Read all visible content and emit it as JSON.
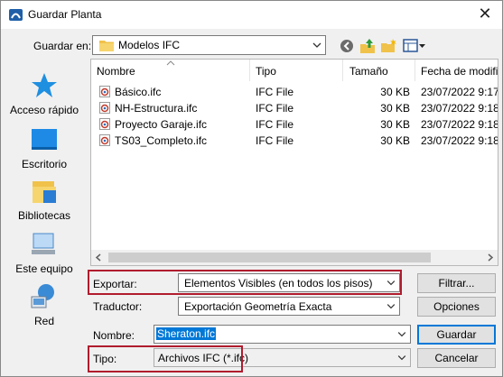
{
  "window": {
    "title": "Guardar Planta",
    "close_glyph": "✕"
  },
  "toolbar": {
    "save_in_label": "Guardar en:",
    "folder": "Modelos IFC",
    "icons": [
      "back-icon",
      "up-folder-icon",
      "new-folder-icon",
      "view-menu-icon"
    ]
  },
  "places": [
    {
      "label": "Acceso rápido",
      "icon": "star-icon"
    },
    {
      "label": "Escritorio",
      "icon": "desktop-icon"
    },
    {
      "label": "Bibliotecas",
      "icon": "libraries-icon"
    },
    {
      "label": "Este equipo",
      "icon": "computer-icon"
    },
    {
      "label": "Red",
      "icon": "network-icon"
    }
  ],
  "columns": [
    "Nombre",
    "Tipo",
    "Tamaño",
    "Fecha de modifi"
  ],
  "files": [
    {
      "name": "Básico.ifc",
      "type": "IFC File",
      "size": "30 KB",
      "date": "23/07/2022 9:17"
    },
    {
      "name": "NH-Estructura.ifc",
      "type": "IFC File",
      "size": "30 KB",
      "date": "23/07/2022 9:18"
    },
    {
      "name": "Proyecto Garaje.ifc",
      "type": "IFC File",
      "size": "30 KB",
      "date": "23/07/2022 9:18"
    },
    {
      "name": "TS03_Completo.ifc",
      "type": "IFC File",
      "size": "30 KB",
      "date": "23/07/2022 9:18"
    }
  ],
  "form": {
    "export_label": "Exportar:",
    "export_value": "Elementos Visibles (en todos los pisos)",
    "filter_button": "Filtrar...",
    "translator_label": "Traductor:",
    "translator_value": "Exportación Geometría Exacta",
    "options_button": "Opciones",
    "name_label": "Nombre:",
    "name_value": "Sheraton.ifc",
    "save_button": "Guardar",
    "type_label": "Tipo:",
    "type_value": "Archivos IFC (*.ifc)",
    "cancel_button": "Cancelar"
  },
  "colors": {
    "highlight": "#b01c2e",
    "selection": "#0078d7"
  }
}
